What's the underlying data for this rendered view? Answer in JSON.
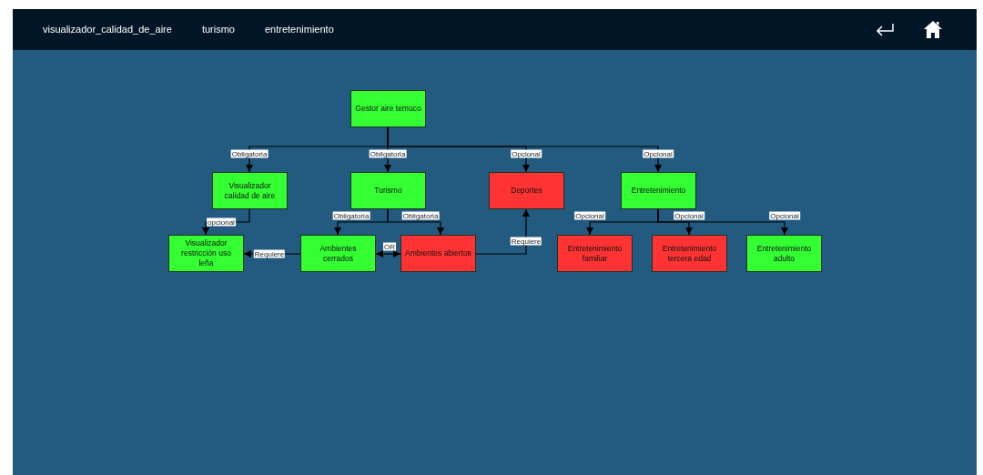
{
  "nav": {
    "links": [
      {
        "label": "visualizador_calidad_de_aire"
      },
      {
        "label": "turismo"
      },
      {
        "label": "entretenimiento"
      }
    ]
  },
  "diagram": {
    "nodes": [
      {
        "text": "Gestor aire temuco",
        "color": "#33ff33"
      },
      {
        "text": "Visualizador calidad de aire",
        "color": "#33ff33"
      },
      {
        "text": "Turismo",
        "color": "#33ff33"
      },
      {
        "text": "Deportes",
        "color": "#ff3333"
      },
      {
        "text": "Entretenimiento",
        "color": "#33ff33"
      },
      {
        "text": "Visualizador restricción uso leña",
        "color": "#33ff33"
      },
      {
        "text": "Ambientes cerrados",
        "color": "#33ff33"
      },
      {
        "text": "Ambientes abiertos",
        "color": "#ff3333"
      },
      {
        "text": "Entretenimiento familiar",
        "color": "#ff3333"
      },
      {
        "text": "Entretenimiento tercera edad",
        "color": "#ff3333"
      },
      {
        "text": "Entretenimiento adulto",
        "color": "#33ff33"
      }
    ],
    "edges": [
      {
        "label": "Obligatoria",
        "kind": "directed"
      },
      {
        "label": "Obligatoria",
        "kind": "directed"
      },
      {
        "label": "Opcional",
        "kind": "directed"
      },
      {
        "label": "Opcional",
        "kind": "directed"
      },
      {
        "label": "opcional",
        "kind": "directed"
      },
      {
        "label": "Obligatoria",
        "kind": "directed"
      },
      {
        "label": "Obligatoria",
        "kind": "directed"
      },
      {
        "label": "Opcional",
        "kind": "directed"
      },
      {
        "label": "Opcional",
        "kind": "directed"
      },
      {
        "label": "Opcional",
        "kind": "directed"
      },
      {
        "label": "Requiere",
        "kind": "directed"
      },
      {
        "label": "OR",
        "kind": "both"
      },
      {
        "label": "Requiere",
        "kind": "directed"
      }
    ]
  }
}
